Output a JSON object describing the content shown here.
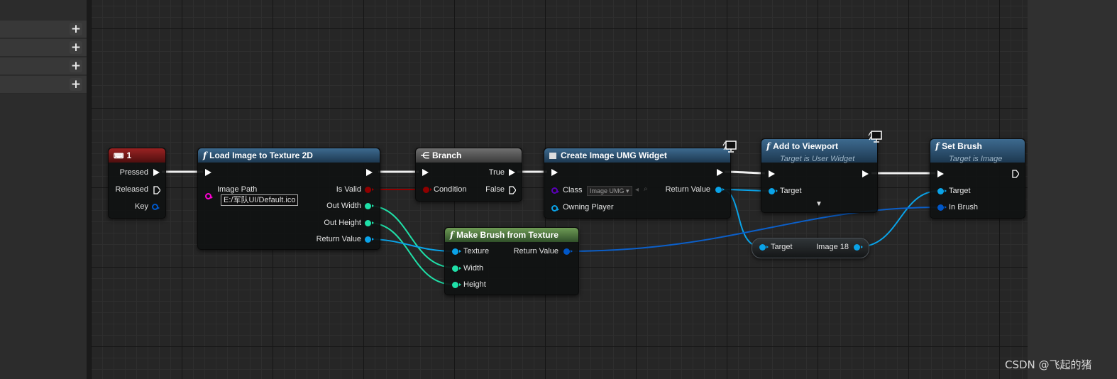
{
  "left_panel": {
    "rows": [
      {
        "add": "+"
      },
      {
        "add": "+"
      },
      {
        "add": "+"
      },
      {
        "add": "+"
      }
    ]
  },
  "nodes": {
    "key_event": {
      "title": "1",
      "pins": {
        "pressed": "Pressed",
        "released": "Released",
        "key": "Key"
      }
    },
    "load_image": {
      "title": "Load Image to Texture 2D",
      "pins": {
        "image_path": "Image Path",
        "image_path_value": "E:/军队UI/Default.ico",
        "is_valid": "Is Valid",
        "out_width": "Out Width",
        "out_height": "Out Height",
        "return_value": "Return Value"
      }
    },
    "branch": {
      "title": "Branch",
      "pins": {
        "condition": "Condition",
        "true": "True",
        "false": "False"
      }
    },
    "create_widget": {
      "title": "Create Image UMG Widget",
      "pins": {
        "class": "Class",
        "class_value": "Image UMG",
        "return_value": "Return Value",
        "owning_player": "Owning Player"
      }
    },
    "add_to_viewport": {
      "title": "Add to Viewport",
      "subtitle": "Target is User Widget",
      "pins": {
        "target": "Target"
      }
    },
    "set_brush": {
      "title": "Set Brush",
      "subtitle": "Target is Image",
      "pins": {
        "target": "Target",
        "in_brush": "In Brush"
      }
    },
    "make_brush": {
      "title": "Make Brush from Texture",
      "pins": {
        "texture": "Texture",
        "width": "Width",
        "height": "Height",
        "return_value": "Return Value"
      }
    },
    "get_image": {
      "pins": {
        "target": "Target",
        "value": "Image 18"
      }
    }
  },
  "colors": {
    "exec": "#ffffff",
    "bool": "#8f0000",
    "int": "#1fe0a8",
    "object": "#0aa3e8",
    "struct": "#0057c8",
    "class": "#5a00b8",
    "string": "#ff00d4"
  },
  "icons": {
    "function": "f",
    "branch": "branch-icon",
    "widget": "widget-icon",
    "monitor": "client-only-monitor-icon",
    "key": "keyboard-icon"
  },
  "watermark": "CSDN @飞起的猪"
}
